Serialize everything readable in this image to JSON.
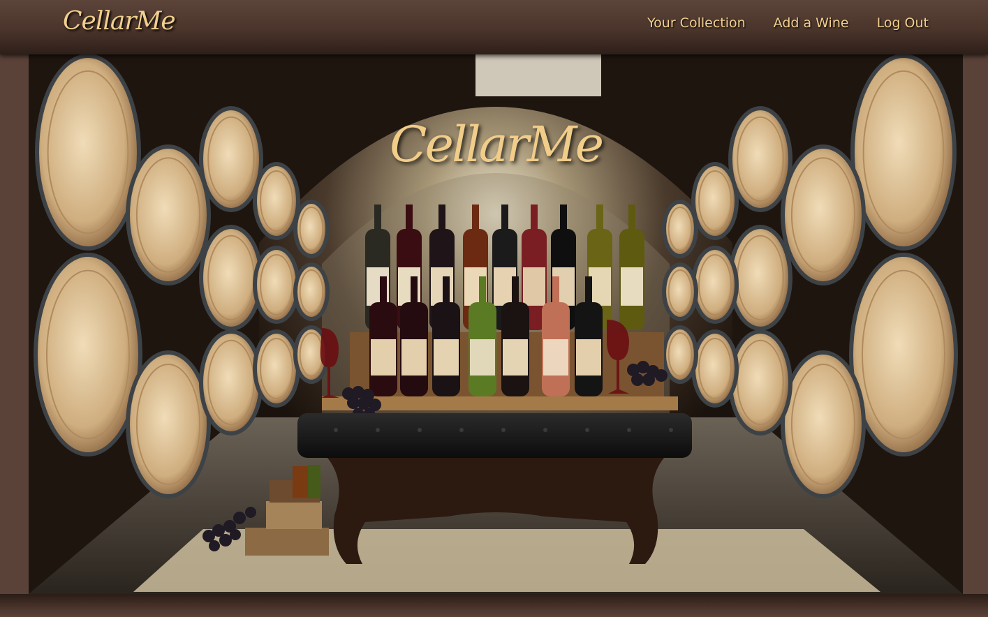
{
  "nav": {
    "brand": "CellarMe",
    "links": [
      {
        "label": "Your Collection"
      },
      {
        "label": "Add a Wine"
      },
      {
        "label": "Log Out"
      }
    ]
  },
  "hero": {
    "title": "CellarMe",
    "image": "wine-cellar-illustration"
  },
  "colors": {
    "accent_gold": "#f1cf8e",
    "nav_brown": "#4a342b",
    "page_brown": "#5a4238"
  }
}
